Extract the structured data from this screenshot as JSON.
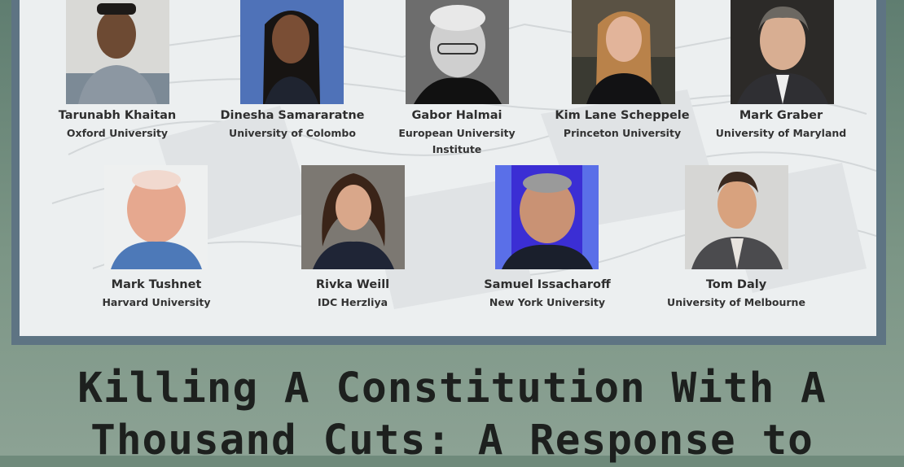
{
  "speakers_row1": [
    {
      "name": "Tarunabh Khaitan",
      "affiliation": "Oxford University"
    },
    {
      "name": "Dinesha Samararatne",
      "affiliation": "University of Colombo"
    },
    {
      "name": "Gabor Halmai",
      "affiliation": "European University Institute"
    },
    {
      "name": "Kim Lane Scheppele",
      "affiliation": "Princeton University"
    },
    {
      "name": "Mark Graber",
      "affiliation": "University of Maryland"
    }
  ],
  "speakers_row2": [
    {
      "name": "Mark Tushnet",
      "affiliation": "Harvard University"
    },
    {
      "name": "Rivka Weill",
      "affiliation": "IDC Herzliya"
    },
    {
      "name": "Samuel Issacharoff",
      "affiliation": "New York University"
    },
    {
      "name": "Tom Daly",
      "affiliation": "University of Melbourne"
    }
  ],
  "title": {
    "line1": "Killing A Constitution With A",
    "line2": "Thousand Cuts: A Response to"
  },
  "colors": {
    "background": "#6f8a7b",
    "frame": "#5e7483",
    "panel": "#e9ecee",
    "title_text": "#1d201e"
  }
}
